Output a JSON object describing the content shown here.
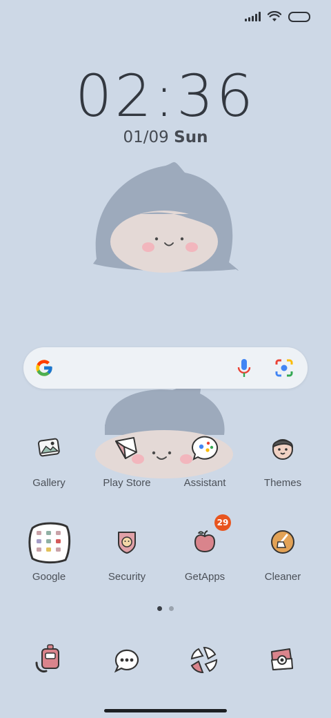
{
  "colors": {
    "background": "#cdd8e6",
    "badge": "#e8551f",
    "search_bg": "#eef2f6"
  },
  "clock": {
    "time": "02:36",
    "date": "01/09",
    "day": "Sun"
  },
  "search": {
    "google_icon": "google-g-icon",
    "mic_icon": "mic-icon",
    "lens_icon": "camera-lens-icon"
  },
  "apps_row1": [
    {
      "label": "Gallery"
    },
    {
      "label": "Play Store"
    },
    {
      "label": "Assistant"
    },
    {
      "label": "Themes"
    }
  ],
  "apps_row2": [
    {
      "label": "Google"
    },
    {
      "label": "Security"
    },
    {
      "label": "GetApps",
      "badge": "29"
    },
    {
      "label": "Cleaner"
    }
  ],
  "pager": {
    "pages": 2,
    "current": 1
  },
  "dock": [
    {
      "icon": "phone-robot-icon"
    },
    {
      "icon": "messages-icon"
    },
    {
      "icon": "browser-icon"
    },
    {
      "icon": "camera-icon"
    }
  ]
}
